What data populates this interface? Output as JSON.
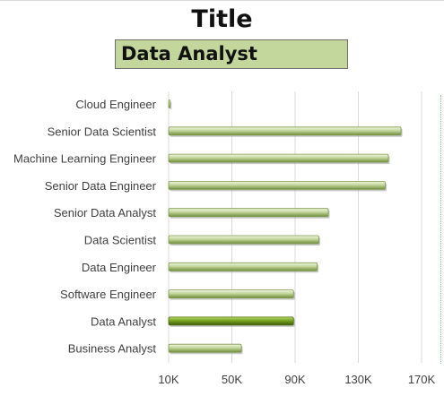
{
  "selected_label": "Data Analyst",
  "chart_data": {
    "type": "bar",
    "orientation": "horizontal",
    "title": "Title",
    "categories": [
      "Cloud Engineer",
      "Senior Data Scientist",
      "Machine Learning Engineer",
      "Senior Data Engineer",
      "Senior Data Analyst",
      "Data Scientist",
      "Data Engineer",
      "Software Engineer",
      "Data Analyst",
      "Business Analyst"
    ],
    "values": [
      11000,
      157000,
      149000,
      147000,
      111000,
      105000,
      104000,
      89000,
      89000,
      56000
    ],
    "highlighted_category": "Data Analyst",
    "x_ticks": [
      10000,
      50000,
      90000,
      130000,
      170000
    ],
    "x_tick_labels": [
      "10K",
      "50K",
      "90K",
      "130K",
      "170K"
    ],
    "xlim": [
      10000,
      170000
    ],
    "grid": true,
    "bar_color": "#c3d69b",
    "highlight_color": "#76a21e"
  }
}
